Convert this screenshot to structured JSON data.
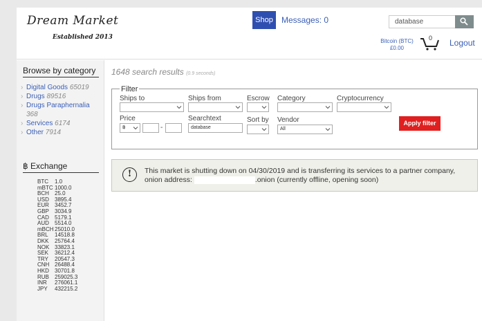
{
  "header": {
    "logo": "Dream Market",
    "established": "Established 2013",
    "shop_label": "Shop",
    "messages_label": "Messages: 0",
    "search_value": "database",
    "bitcoin_label": "Bitcoin (BTC)",
    "bitcoin_balance": "£0.00",
    "cart_count": "0",
    "logout_label": "Logout"
  },
  "sidebar": {
    "title": "Browse by category",
    "categories": [
      {
        "label": "Digital Goods",
        "count": "65019"
      },
      {
        "label": "Drugs",
        "count": "89516"
      },
      {
        "label": "Drugs Paraphernalia",
        "count": "368"
      },
      {
        "label": "Services",
        "count": "6174"
      },
      {
        "label": "Other",
        "count": "7914"
      }
    ],
    "exchange_title": "฿ Exchange",
    "rates": [
      {
        "code": "BTC",
        "value": "1.0"
      },
      {
        "code": "mBTC",
        "value": "1000.0"
      },
      {
        "code": "BCH",
        "value": "25.0"
      },
      {
        "code": "USD",
        "value": "3895.4"
      },
      {
        "code": "EUR",
        "value": "3452.7"
      },
      {
        "code": "GBP",
        "value": "3034.9"
      },
      {
        "code": "CAD",
        "value": "5179.1"
      },
      {
        "code": "AUD",
        "value": "5514.0"
      },
      {
        "code": "mBCH",
        "value": "25010.0"
      },
      {
        "code": "BRL",
        "value": "14518.8"
      },
      {
        "code": "DKK",
        "value": "25764.4"
      },
      {
        "code": "NOK",
        "value": "33823.1"
      },
      {
        "code": "SEK",
        "value": "36212.4"
      },
      {
        "code": "TRY",
        "value": "20547.3"
      },
      {
        "code": "CNH",
        "value": "26488.4"
      },
      {
        "code": "HKD",
        "value": "30701.8"
      },
      {
        "code": "RUB",
        "value": "259025.3"
      },
      {
        "code": "INR",
        "value": "276061.1"
      },
      {
        "code": "JPY",
        "value": "432215.2"
      }
    ]
  },
  "main": {
    "results_text": "1648 search results",
    "results_time": "(0.9 seconds)",
    "filter": {
      "legend": "Filter",
      "ships_to": "Ships to",
      "ships_from": "Ships from",
      "escrow": "Escrow",
      "category": "Category",
      "cryptocurrency": "Cryptocurrency",
      "price": "Price",
      "price_currency": "฿",
      "searchtext": "Searchtext",
      "searchtext_value": "database",
      "sort_by": "Sort by",
      "vendor": "Vendor",
      "vendor_value": "All",
      "apply_label": "Apply filter"
    },
    "notice": {
      "icon": "!",
      "text_before": "This market is shutting down on 04/30/2019 and is transferring its services to a partner company, onion address: ",
      "text_after": ".onion (currently offline, opening soon)"
    }
  }
}
